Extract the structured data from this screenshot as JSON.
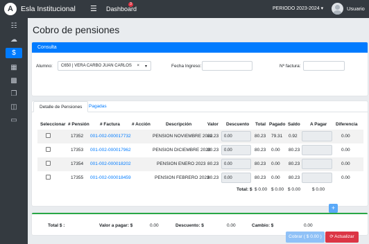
{
  "topbar": {
    "brand": "Esla Institucional",
    "logo_letter": "A",
    "menu_icon": "hamburger-icon",
    "dashboard": "Dashboard",
    "badge": "3",
    "periodo": "PERIODO 2023-2024",
    "user": "Usuario"
  },
  "sidebar": {
    "items": [
      "sitemap-icon",
      "cloud-icon",
      "dollar-circle-icon",
      "calendar-icon",
      "save-icon",
      "copy-icon",
      "gift-icon",
      "monitor-icon"
    ],
    "active_index": 2
  },
  "page": {
    "title": "Cobro de pensiones"
  },
  "consulta": {
    "header": "Consulta",
    "alumno_label": "Alumno:",
    "alumno_value": "C650 | VERA CARBO JUAN CARLOS",
    "fecha_label": "Fecha Ingreso:",
    "fecha_value": "",
    "factura_label": "Nº factura:",
    "factura_value": ""
  },
  "tabs": {
    "detalle": "Detalle de Pensiones",
    "pagadas": "Pagadas"
  },
  "table": {
    "headers": [
      "Seleccionar",
      "# Pensión",
      "# Factura",
      "# Acción",
      "Descripción",
      "Valor",
      "Descuento",
      "Total",
      "Pagado",
      "Saldo",
      "A Pagar",
      "Diferencia"
    ],
    "rows": [
      {
        "pension": "17352",
        "factura": "001-002-000017732",
        "descripcion": "PENSION NOVIEMBRE 2022",
        "valor": "80.23",
        "descuento": "0.00",
        "total": "80.23",
        "pagado": "79.31",
        "saldo": "0.92",
        "apagar": "",
        "diferencia": "0.00"
      },
      {
        "pension": "17353",
        "factura": "001-002-000017962",
        "descripcion": "PENSION DICIEMBRE 2022",
        "valor": "80.23",
        "descuento": "0.00",
        "total": "80.23",
        "pagado": "0.00",
        "saldo": "80.23",
        "apagar": "",
        "diferencia": "0.00"
      },
      {
        "pension": "17354",
        "factura": "001-002-000018202",
        "descripcion": "PENSION ENERO 2023",
        "valor": "80.23",
        "descuento": "0.00",
        "total": "80.23",
        "pagado": "0.00",
        "saldo": "80.23",
        "apagar": "",
        "diferencia": "0.00"
      },
      {
        "pension": "17355",
        "factura": "001-002-000018459",
        "descripcion": "PENSION FEBRERO 2023",
        "valor": "80.23",
        "descuento": "0.00",
        "total": "80.23",
        "pagado": "0.00",
        "saldo": "80.23",
        "apagar": "",
        "diferencia": "0.00"
      }
    ],
    "totals": {
      "label": "Total: $",
      "total": "$ 0.00",
      "pagado": "$ 0.00",
      "saldo": "$ 0.00",
      "apagar": "$ 0.00"
    }
  },
  "summary": {
    "total_label": "Total $ :",
    "valor_label": "Valor a pagar: $",
    "valor_value": "0.00",
    "descuento_label": "Descuento: $",
    "descuento_value": "0.00",
    "cambio_label": "Cambio: $",
    "cambio_value": "0.00"
  },
  "actions": {
    "cobrar": "Cobrar ( $ 0.00 )",
    "actualizar": "Actualizar"
  }
}
